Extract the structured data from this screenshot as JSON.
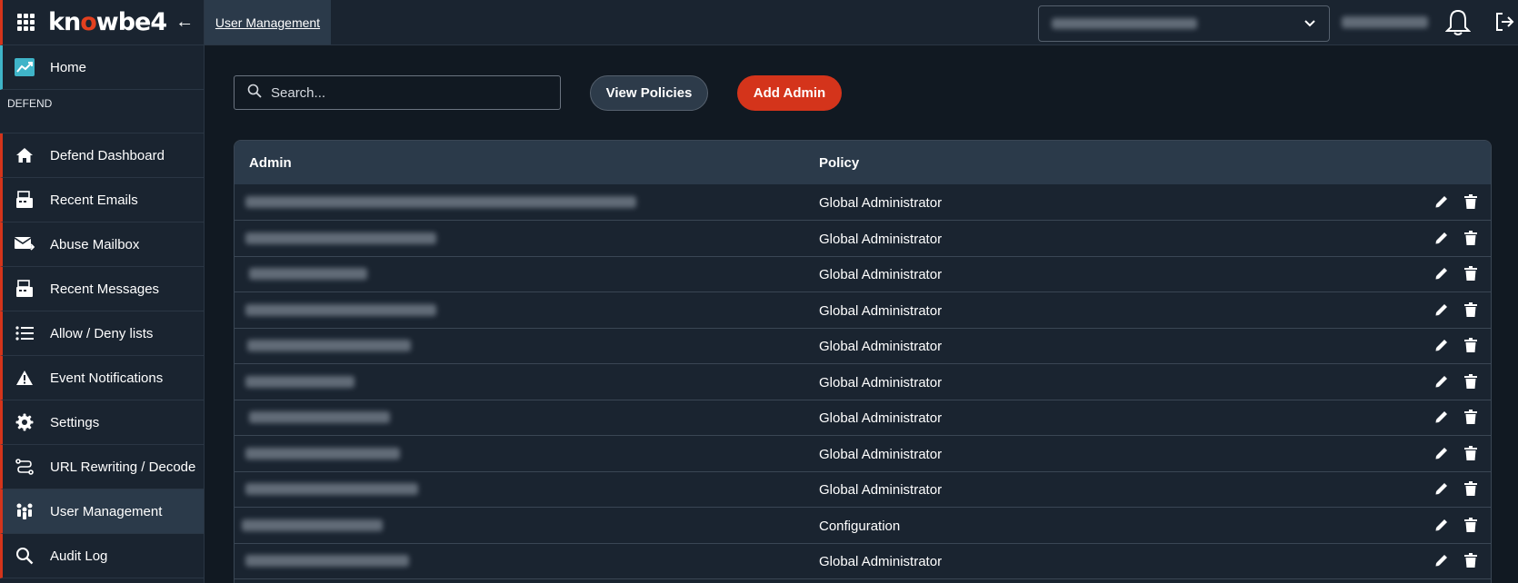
{
  "brand": {
    "logo_text": "knowbe4"
  },
  "topbar": {
    "breadcrumb": "User Management",
    "account_selected": "[redacted]",
    "user_name": "[redacted]"
  },
  "sidebar": {
    "home": "Home",
    "section_label": "DEFEND",
    "items": [
      {
        "label": "Defend Dashboard",
        "icon": "home-icon"
      },
      {
        "label": "Recent Emails",
        "icon": "inbox-icon"
      },
      {
        "label": "Abuse Mailbox",
        "icon": "mail-forward-icon"
      },
      {
        "label": "Recent Messages",
        "icon": "inbox-icon"
      },
      {
        "label": "Allow / Deny lists",
        "icon": "list-icon"
      },
      {
        "label": "Event Notifications",
        "icon": "warning-icon"
      },
      {
        "label": "Settings",
        "icon": "gear-icon"
      },
      {
        "label": "URL Rewriting / Decode",
        "icon": "route-icon"
      },
      {
        "label": "User Management",
        "icon": "users-icon"
      },
      {
        "label": "Audit Log",
        "icon": "search-icon"
      }
    ]
  },
  "toolbar": {
    "search_placeholder": "Search...",
    "view_policies": "View Policies",
    "add_admin": "Add Admin"
  },
  "table": {
    "columns": [
      "Admin",
      "Policy"
    ],
    "rows": [
      {
        "admin": "[redacted email]",
        "policy": "Global Administrator"
      },
      {
        "admin": "[redacted email]",
        "policy": "Global Administrator"
      },
      {
        "admin": "[redacted email]",
        "policy": "Global Administrator"
      },
      {
        "admin": "[redacted email]",
        "policy": "Global Administrator"
      },
      {
        "admin": "[redacted email]",
        "policy": "Global Administrator"
      },
      {
        "admin": "[redacted email]",
        "policy": "Global Administrator"
      },
      {
        "admin": "[redacted email]",
        "policy": "Global Administrator"
      },
      {
        "admin": "[redacted email]",
        "policy": "Global Administrator"
      },
      {
        "admin": "[redacted email]",
        "policy": "Global Administrator"
      },
      {
        "admin": "[redacted email]",
        "policy": "Configuration"
      },
      {
        "admin": "[redacted email]",
        "policy": "Global Administrator"
      }
    ]
  },
  "colors": {
    "accent_red": "#d4341b",
    "accent_teal": "#3fb4c8",
    "sidebar_bg": "#1a2430",
    "page_bg": "#111922"
  }
}
